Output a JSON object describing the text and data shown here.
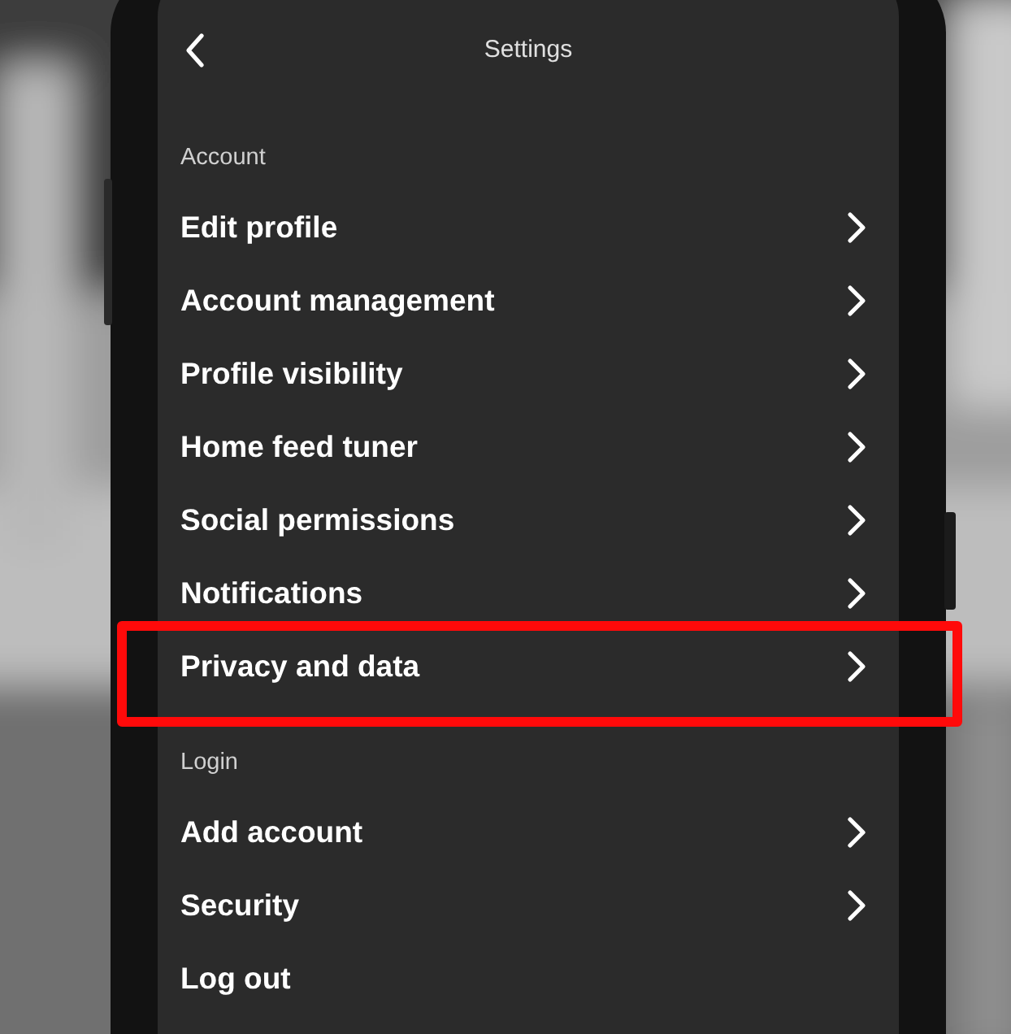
{
  "header": {
    "title": "Settings"
  },
  "sections": [
    {
      "label": "Account",
      "items": [
        {
          "label": "Edit profile",
          "kind": "nav",
          "highlighted": false
        },
        {
          "label": "Account management",
          "kind": "nav",
          "highlighted": false
        },
        {
          "label": "Profile visibility",
          "kind": "nav",
          "highlighted": false
        },
        {
          "label": "Home feed tuner",
          "kind": "nav",
          "highlighted": false
        },
        {
          "label": "Social permissions",
          "kind": "nav",
          "highlighted": false
        },
        {
          "label": "Notifications",
          "kind": "nav",
          "highlighted": false
        },
        {
          "label": "Privacy and data",
          "kind": "nav",
          "highlighted": true
        }
      ]
    },
    {
      "label": "Login",
      "items": [
        {
          "label": "Add account",
          "kind": "nav",
          "highlighted": false
        },
        {
          "label": "Security",
          "kind": "nav",
          "highlighted": false
        },
        {
          "label": "Log out",
          "kind": "action",
          "highlighted": false
        }
      ]
    }
  ]
}
